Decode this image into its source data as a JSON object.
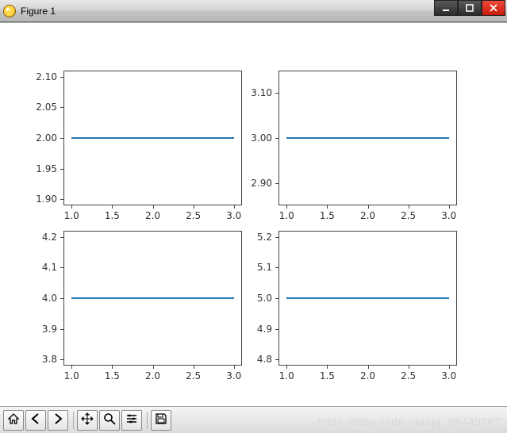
{
  "window": {
    "title": "Figure 1"
  },
  "watermark": "https://blog.csdn.net/qq_26449287",
  "toolbar": {
    "home": "Home",
    "back": "Back",
    "forward": "Forward",
    "pan": "Pan",
    "zoom": "Zoom",
    "configure": "Configure subplots",
    "save": "Save"
  },
  "chart_data": [
    {
      "type": "line",
      "x": [
        1,
        2,
        3
      ],
      "y": [
        2,
        2,
        2
      ],
      "xlabel": "",
      "ylabel": "",
      "title": "",
      "xticks": [
        1.0,
        1.5,
        2.0,
        2.5,
        3.0
      ],
      "yticks": [
        1.9,
        1.95,
        2.0,
        2.05,
        2.1
      ],
      "xlim": [
        0.9,
        3.1
      ],
      "ylim": [
        1.89,
        2.11
      ]
    },
    {
      "type": "line",
      "x": [
        1,
        2,
        3
      ],
      "y": [
        3,
        3,
        3
      ],
      "xlabel": "",
      "ylabel": "",
      "title": "",
      "xticks": [
        1.0,
        1.5,
        2.0,
        2.5,
        3.0
      ],
      "yticks": [
        2.9,
        3.0,
        3.1
      ],
      "xlim": [
        0.9,
        3.1
      ],
      "ylim": [
        2.85,
        3.15
      ]
    },
    {
      "type": "line",
      "x": [
        1,
        2,
        3
      ],
      "y": [
        4,
        4,
        4
      ],
      "xlabel": "",
      "ylabel": "",
      "title": "",
      "xticks": [
        1.0,
        1.5,
        2.0,
        2.5,
        3.0
      ],
      "yticks": [
        3.8,
        3.9,
        4.0,
        4.1,
        4.2
      ],
      "xlim": [
        0.9,
        3.1
      ],
      "ylim": [
        3.78,
        4.22
      ]
    },
    {
      "type": "line",
      "x": [
        1,
        2,
        3
      ],
      "y": [
        5,
        5,
        5
      ],
      "xlabel": "",
      "ylabel": "",
      "title": "",
      "xticks": [
        1.0,
        1.5,
        2.0,
        2.5,
        3.0
      ],
      "yticks": [
        4.8,
        4.9,
        5.0,
        5.1,
        5.2
      ],
      "xlim": [
        0.9,
        3.1
      ],
      "ylim": [
        4.78,
        5.22
      ]
    }
  ]
}
